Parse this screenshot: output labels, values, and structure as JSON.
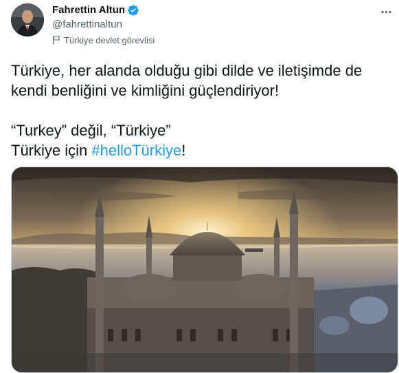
{
  "author": {
    "display_name": "Fahrettin Altun",
    "handle": "@fahrettinaltun",
    "label": "Türkiye devlet görevlisi",
    "verified": true,
    "verified_color": "#1d9bf0"
  },
  "tweet": {
    "line1": "Türkiye, her alanda olduğu gibi dilde ve iletişimde de",
    "line2": "kendi benliğini ve kimliğini güçlendiriyor!",
    "line3": "“Turkey” değil, “Türkiye”",
    "line4_prefix": "Türkiye için ",
    "hashtag": "#helloTürkiye",
    "line4_suffix": "!"
  },
  "icons": {
    "more": "more-horizontal-icon",
    "verified": "verified-badge-icon",
    "flag": "flag-icon"
  },
  "colors": {
    "text": "#0f1419",
    "secondary": "#536471",
    "accent": "#1d9bf0"
  }
}
